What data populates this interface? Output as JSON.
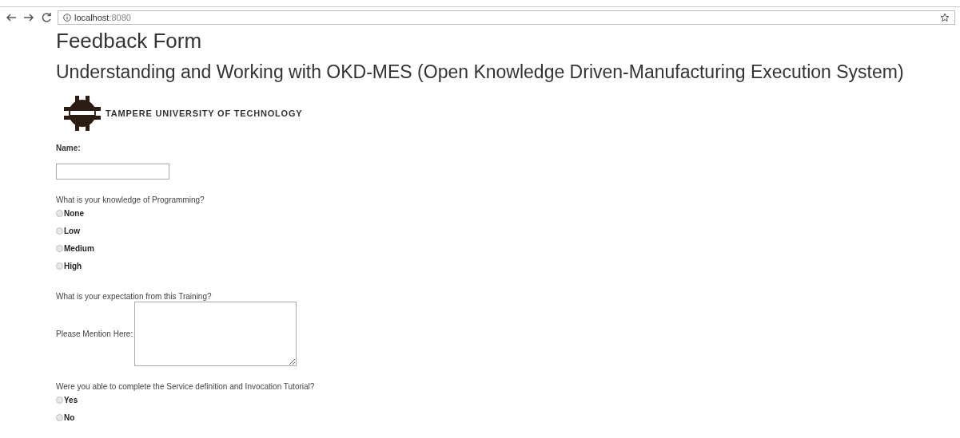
{
  "browser": {
    "url_host": "localhost",
    "url_port": ":8080"
  },
  "title": "Feedback Form",
  "subtitle": "Understanding and Working with OKD-MES (Open Knowledge Driven-Manufacturing Execution System)",
  "logo_text": "TAMPERE UNIVERSITY OF TECHNOLOGY",
  "name_label": "Name:",
  "q1": {
    "question": "What is your knowledge of Programming?",
    "options": [
      {
        "label": "None",
        "selected": false
      },
      {
        "label": "Low",
        "selected": false
      },
      {
        "label": "Medium",
        "selected": false
      },
      {
        "label": "High",
        "selected": false
      }
    ]
  },
  "q2": {
    "question": "What is your expectation from this Training?",
    "label": "Please Mention Here:"
  },
  "q3": {
    "question": "Were you able to complete the Service definition and Invocation Tutorial?",
    "options": [
      {
        "label": "Yes",
        "selected": false
      },
      {
        "label": "No",
        "selected": false
      }
    ]
  }
}
